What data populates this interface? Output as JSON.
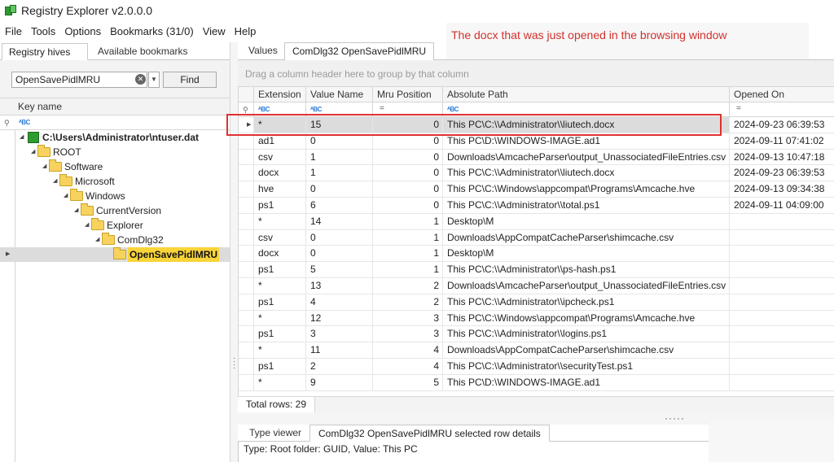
{
  "window": {
    "title": "Registry Explorer v2.0.0.0"
  },
  "menu": [
    "File",
    "Tools",
    "Options",
    "Bookmarks (31/0)",
    "View",
    "Help"
  ],
  "annotation": "The docx that was just opened in the browsing window",
  "left": {
    "tabs": [
      "Registry hives (1)",
      "Available bookmarks (32/0)"
    ],
    "search": {
      "value": "OpenSavePidlMRU",
      "find_label": "Find"
    },
    "column_header": "Key name",
    "tree": [
      {
        "label": "C:\\Users\\Administrator\\ntuser.dat",
        "kind": "hive"
      },
      {
        "label": "ROOT",
        "kind": "folder"
      },
      {
        "label": "Software",
        "kind": "folder"
      },
      {
        "label": "Microsoft",
        "kind": "folder"
      },
      {
        "label": "Windows",
        "kind": "folder"
      },
      {
        "label": "CurrentVersion",
        "kind": "folder"
      },
      {
        "label": "Explorer",
        "kind": "folder"
      },
      {
        "label": "ComDlg32",
        "kind": "folder"
      },
      {
        "label": "OpenSavePidlMRU",
        "kind": "folder",
        "selected": true
      }
    ]
  },
  "right": {
    "tabs": [
      "Values",
      "ComDlg32 OpenSavePidlMRU"
    ],
    "group_hint": "Drag a column header here to group by that column",
    "columns": [
      "Extension",
      "Value Name",
      "Mru Position",
      "Absolute Path",
      "Opened On"
    ],
    "rows": [
      {
        "ext": "*",
        "value": "15",
        "mru": "0",
        "path": "This PC\\C:\\\\Administrator\\\\liutech.docx",
        "opened": "2024-09-23 06:39:53",
        "selected": true
      },
      {
        "ext": "ad1",
        "value": "0",
        "mru": "0",
        "path": "This PC\\D:\\WINDOWS-IMAGE.ad1",
        "opened": "2024-09-11 07:41:02"
      },
      {
        "ext": "csv",
        "value": "1",
        "mru": "0",
        "path": "Downloads\\AmcacheParser\\output_UnassociatedFileEntries.csv",
        "opened": "2024-09-13 10:47:18"
      },
      {
        "ext": "docx",
        "value": "1",
        "mru": "0",
        "path": "This PC\\C:\\\\Administrator\\\\liutech.docx",
        "opened": "2024-09-23 06:39:53"
      },
      {
        "ext": "hve",
        "value": "0",
        "mru": "0",
        "path": "This PC\\C:\\Windows\\appcompat\\Programs\\Amcache.hve",
        "opened": "2024-09-13 09:34:38"
      },
      {
        "ext": "ps1",
        "value": "6",
        "mru": "0",
        "path": "This PC\\C:\\\\Administrator\\\\total.ps1",
        "opened": "2024-09-11 04:09:00"
      },
      {
        "ext": "*",
        "value": "14",
        "mru": "1",
        "path": "Desktop\\M",
        "opened": ""
      },
      {
        "ext": "csv",
        "value": "0",
        "mru": "1",
        "path": "Downloads\\AppCompatCacheParser\\shimcache.csv",
        "opened": ""
      },
      {
        "ext": "docx",
        "value": "0",
        "mru": "1",
        "path": "Desktop\\M",
        "opened": ""
      },
      {
        "ext": "ps1",
        "value": "5",
        "mru": "1",
        "path": "This PC\\C:\\\\Administrator\\\\ps-hash.ps1",
        "opened": ""
      },
      {
        "ext": "*",
        "value": "13",
        "mru": "2",
        "path": "Downloads\\AmcacheParser\\output_UnassociatedFileEntries.csv",
        "opened": ""
      },
      {
        "ext": "ps1",
        "value": "4",
        "mru": "2",
        "path": "This PC\\C:\\\\Administrator\\\\ipcheck.ps1",
        "opened": ""
      },
      {
        "ext": "*",
        "value": "12",
        "mru": "3",
        "path": "This PC\\C:\\Windows\\appcompat\\Programs\\Amcache.hve",
        "opened": ""
      },
      {
        "ext": "ps1",
        "value": "3",
        "mru": "3",
        "path": "This PC\\C:\\\\Administrator\\\\logins.ps1",
        "opened": ""
      },
      {
        "ext": "*",
        "value": "11",
        "mru": "4",
        "path": "Downloads\\AppCompatCacheParser\\shimcache.csv",
        "opened": ""
      },
      {
        "ext": "ps1",
        "value": "2",
        "mru": "4",
        "path": "This PC\\C:\\\\Administrator\\\\securityTest.ps1",
        "opened": ""
      },
      {
        "ext": "*",
        "value": "9",
        "mru": "5",
        "path": "This PC\\D:\\WINDOWS-IMAGE.ad1",
        "opened": ""
      }
    ],
    "total_rows": "Total rows: 29",
    "bottom_tabs": [
      "Type viewer",
      "ComDlg32 OpenSavePidlMRU selected row details"
    ],
    "details": "Type: Root folder: GUID, Value: This PC"
  }
}
